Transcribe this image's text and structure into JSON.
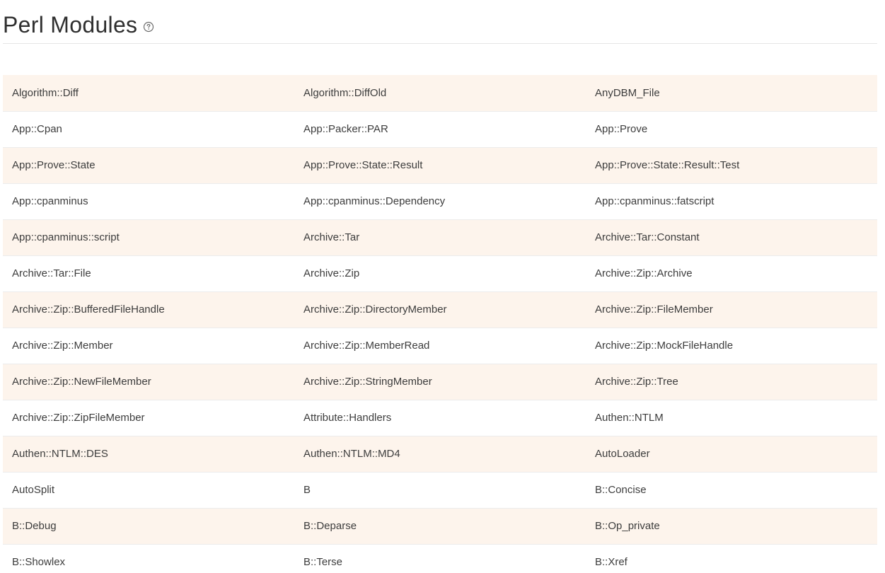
{
  "page": {
    "title": "Perl Modules",
    "help_icon": "question-circle-icon"
  },
  "colors": {
    "row_stripe": "#fdf4ec",
    "row_plain": "#ffffff",
    "text": "#3d3d3d",
    "divider": "#e6e6e6"
  },
  "modules": {
    "rows": [
      [
        "Algorithm::Diff",
        "Algorithm::DiffOld",
        "AnyDBM_File"
      ],
      [
        "App::Cpan",
        "App::Packer::PAR",
        "App::Prove"
      ],
      [
        "App::Prove::State",
        "App::Prove::State::Result",
        "App::Prove::State::Result::Test"
      ],
      [
        "App::cpanminus",
        "App::cpanminus::Dependency",
        "App::cpanminus::fatscript"
      ],
      [
        "App::cpanminus::script",
        "Archive::Tar",
        "Archive::Tar::Constant"
      ],
      [
        "Archive::Tar::File",
        "Archive::Zip",
        "Archive::Zip::Archive"
      ],
      [
        "Archive::Zip::BufferedFileHandle",
        "Archive::Zip::DirectoryMember",
        "Archive::Zip::FileMember"
      ],
      [
        "Archive::Zip::Member",
        "Archive::Zip::MemberRead",
        "Archive::Zip::MockFileHandle"
      ],
      [
        "Archive::Zip::NewFileMember",
        "Archive::Zip::StringMember",
        "Archive::Zip::Tree"
      ],
      [
        "Archive::Zip::ZipFileMember",
        "Attribute::Handlers",
        "Authen::NTLM"
      ],
      [
        "Authen::NTLM::DES",
        "Authen::NTLM::MD4",
        "AutoLoader"
      ],
      [
        "AutoSplit",
        "B",
        "B::Concise"
      ],
      [
        "B::Debug",
        "B::Deparse",
        "B::Op_private"
      ],
      [
        "B::Showlex",
        "B::Terse",
        "B::Xref"
      ]
    ]
  }
}
